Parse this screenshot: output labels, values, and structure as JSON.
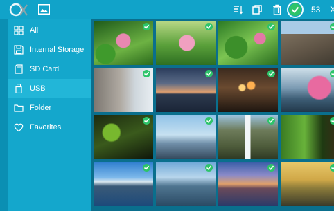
{
  "toolbar": {
    "app_icon": "app-logo-icon",
    "gallery_icon": "image-gallery-icon",
    "sort_icon": "sort-list-icon",
    "copy_icon": "copy-icon",
    "delete_icon": "trash-icon",
    "select_all_icon": "check-circle-icon",
    "selected_count": "53",
    "more_label": "X"
  },
  "sidebar": {
    "items": [
      {
        "label": "All",
        "icon": "grid-icon",
        "selected": false
      },
      {
        "label": "Internal Storage",
        "icon": "floppy-disk-icon",
        "selected": false
      },
      {
        "label": "SD Card",
        "icon": "sd-card-icon",
        "selected": false
      },
      {
        "label": "USB",
        "icon": "usb-icon",
        "selected": true
      },
      {
        "label": "Folder",
        "icon": "folder-icon",
        "selected": false
      },
      {
        "label": "Favorites",
        "icon": "heart-icon",
        "selected": false
      }
    ]
  },
  "thumbnails": [
    {
      "name": "lotus-pink",
      "checked": true
    },
    {
      "name": "lotus-pink-2",
      "checked": true
    },
    {
      "name": "lotus-leaves",
      "checked": true
    },
    {
      "name": "rock-cliff",
      "checked": true
    },
    {
      "name": "heart-carving",
      "checked": true
    },
    {
      "name": "pier-dusk",
      "checked": true
    },
    {
      "name": "bokeh-lights",
      "checked": true
    },
    {
      "name": "blossom-lake",
      "checked": true
    },
    {
      "name": "green-fern",
      "checked": true
    },
    {
      "name": "misty-mountain",
      "checked": true
    },
    {
      "name": "waterfall",
      "checked": true
    },
    {
      "name": "green-tree",
      "checked": true
    },
    {
      "name": "lake-city",
      "checked": true
    },
    {
      "name": "mountain-blue",
      "checked": true
    },
    {
      "name": "sunset-coast",
      "checked": true
    },
    {
      "name": "golden-field",
      "checked": true
    }
  ],
  "colors": {
    "topbar": "#11a3c9",
    "sidebar": "#14a7cc",
    "sidebar_selected": "#22b6d8",
    "check": "#2ec46a"
  }
}
